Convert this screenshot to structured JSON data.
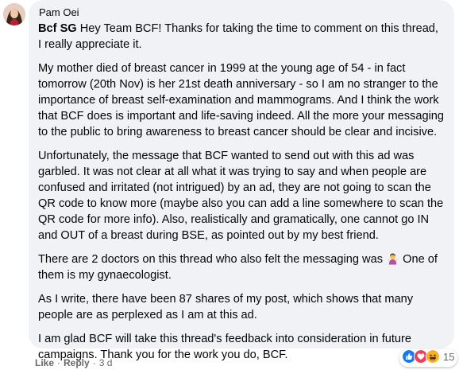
{
  "comment": {
    "author": "Pam Oei",
    "mention": "Bcf SG",
    "paragraphs": {
      "p1": "Hey Team BCF! Thanks for taking the time to comment on this thread, I really appreciate it.",
      "p2": "My mother died of breast cancer in 1999 at the young age of 54 - in fact tomorrow (20th Nov) is her 21st death anniversary - so I am no stranger to the importance of breast self-examination and mammograms. And I think the work that BCF does is important and life-saving indeed. All the more your messaging to the public to bring awareness to breast cancer should be clear and incisive.",
      "p3": "Unfortunately, the message that BCF wanted to send out with this ad was garbled. It was not clear at all what it was trying to say and when people are confused and irritated (not intrigued) by an ad, they are not going to scan the QR code to know more (maybe also you can add a line somewhere to scan the QR code for more info). Also, realistically and gramatically, one cannot go IN and OUT of a breast during BSE, as pointed out by my best friend.",
      "p4a": "There are 2 doctors on this thread who also felt the messaging was",
      "p4b": "One of them is my gynaecologist.",
      "p5": "As I write, there have been 87 shares of my post, which shows that many people are as perplexed as I am at this ad.",
      "p6": "I am glad BCF will take this thread's feedback into consideration in future campaigns. Thank you for the work you do, BCF."
    },
    "inline_emoji": "person-shrugging-emoji"
  },
  "reactions": {
    "icons": [
      "like-icon",
      "love-icon",
      "haha-icon"
    ],
    "count": "15"
  },
  "actions": {
    "like": "Like",
    "reply": "Reply",
    "separator": "·",
    "time": "3 d"
  },
  "colors": {
    "bubble": "#f0f2f5",
    "text": "#050505",
    "secondary": "#65676b",
    "like_blue": "#1877f2",
    "love_red": "#f33e58",
    "haha_yellow": "#f7b125"
  }
}
